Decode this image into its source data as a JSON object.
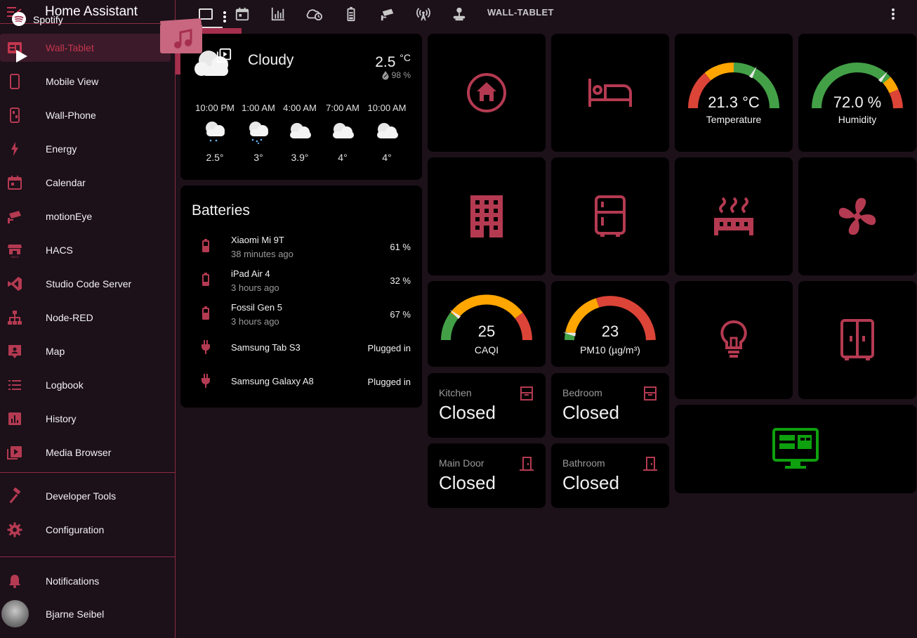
{
  "app": {
    "title": "Home Assistant"
  },
  "colors": {
    "accent": "#c4364f",
    "icon_red": "#b43a51",
    "green": "#0ea00e",
    "gauge_red": "#db4437",
    "gauge_yellow": "#ffa600",
    "gauge_green": "#43a047"
  },
  "sidebar": {
    "items": [
      {
        "label": "Wall-Tablet",
        "icon": "tablet-dashboard-icon"
      },
      {
        "label": "Mobile View",
        "icon": "cellphone-icon"
      },
      {
        "label": "Wall-Phone",
        "icon": "phone-dashboard-icon"
      },
      {
        "label": "Energy",
        "icon": "lightning-icon"
      },
      {
        "label": "Calendar",
        "icon": "calendar-icon"
      },
      {
        "label": "motionEye",
        "icon": "cctv-icon"
      },
      {
        "label": "HACS",
        "icon": "hacs-icon"
      },
      {
        "label": "Studio Code Server",
        "icon": "vscode-icon"
      },
      {
        "label": "Node-RED",
        "icon": "sitemap-icon"
      },
      {
        "label": "Map",
        "icon": "map-icon"
      },
      {
        "label": "Logbook",
        "icon": "list-icon"
      },
      {
        "label": "History",
        "icon": "chart-icon"
      },
      {
        "label": "Media Browser",
        "icon": "play-box-icon"
      }
    ],
    "tools": [
      {
        "label": "Developer Tools",
        "icon": "hammer-icon"
      },
      {
        "label": "Configuration",
        "icon": "gear-icon"
      }
    ],
    "notifications": "Notifications",
    "user": "Bjarne Seibel"
  },
  "topbar": {
    "title": "WALL-TABLET",
    "tabs": [
      "tablet-icon",
      "calendar-icon",
      "chart-icon",
      "clock-cloud-icon",
      "battery-icon",
      "cctv-icon",
      "antenna-icon",
      "robot-vacuum-icon"
    ]
  },
  "weather": {
    "condition": "Cloudy",
    "temperature": "2.5",
    "unit": "°C",
    "humidity": "98 %",
    "forecast": [
      {
        "time": "10:00 PM",
        "temp": "2.5°",
        "icon": "rain-cloud-icon"
      },
      {
        "time": "1:00 AM",
        "temp": "3°",
        "icon": "rain-cloud-icon"
      },
      {
        "time": "4:00 AM",
        "temp": "3.9°",
        "icon": "cloud-icon"
      },
      {
        "time": "7:00 AM",
        "temp": "4°",
        "icon": "cloud-icon"
      },
      {
        "time": "10:00 AM",
        "temp": "4°",
        "icon": "cloud-icon"
      }
    ]
  },
  "batteries": {
    "title": "Batteries",
    "items": [
      {
        "name": "Xiaomi Mi 9T",
        "sub": "38 minutes ago",
        "value": "61 %",
        "icon": "battery-icon"
      },
      {
        "name": "iPad Air 4",
        "sub": "3 hours ago",
        "value": "32 %",
        "icon": "battery-icon"
      },
      {
        "name": "Fossil Gen 5",
        "sub": "3 hours ago",
        "value": "67 %",
        "icon": "battery-icon"
      },
      {
        "name": "Samsung Tab S3",
        "sub": "",
        "value": "Plugged in",
        "icon": "plug-icon"
      },
      {
        "name": "Samsung Galaxy A8",
        "sub": "",
        "value": "Plugged in",
        "icon": "plug-icon"
      }
    ]
  },
  "spotify": {
    "name": "Spotify"
  },
  "gauges": {
    "temperature": {
      "value": "21.3 °C",
      "name": "Temperature",
      "level": 0.66
    },
    "humidity": {
      "value": "72.0 %",
      "name": "Humidity",
      "level": 0.72
    },
    "caqi": {
      "value": "25",
      "name": "CAQI",
      "level": 0.22
    },
    "pm10": {
      "value": "23",
      "name": "PM10 (µg/m³)",
      "level": 0.05
    }
  },
  "doors": [
    {
      "name": "Kitchen",
      "state": "Closed",
      "icon": "window-closed-icon"
    },
    {
      "name": "Bedroom",
      "state": "Closed",
      "icon": "window-closed-icon"
    },
    {
      "name": "Main Door",
      "state": "Closed",
      "icon": "door-closed-icon"
    },
    {
      "name": "Bathroom",
      "state": "Closed",
      "icon": "door-closed-icon"
    }
  ]
}
